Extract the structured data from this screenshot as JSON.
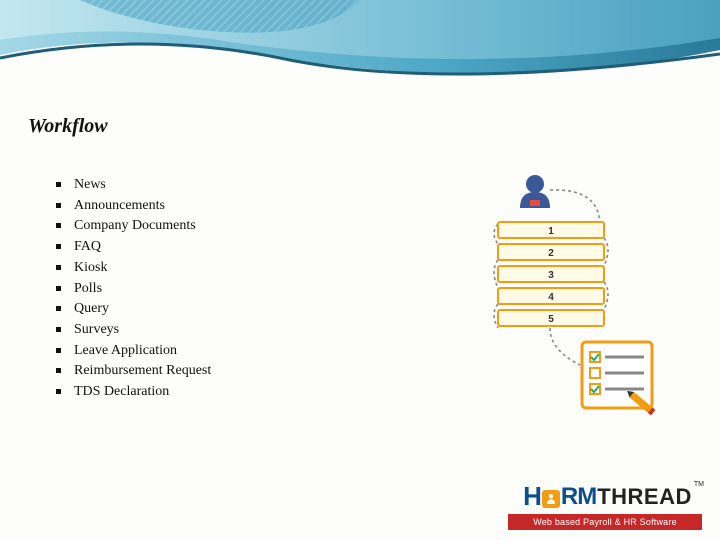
{
  "title": "Workflow",
  "bullets": [
    "News",
    "Announcements",
    "Company Documents",
    "FAQ",
    "Kiosk",
    "Polls",
    "Query",
    "Surveys",
    "Leave Application",
    "Reimbursement Request",
    "TDS Declaration"
  ],
  "diagram": {
    "steps": [
      "1",
      "2",
      "3",
      "4",
      "5"
    ],
    "colors": {
      "person_head": "#3b5998",
      "person_body": "#3b5998",
      "arrow_stroke": "#888",
      "step_border": "#f39c12",
      "step_fill": "#fffbe6",
      "step_text": "#333",
      "clipboard_border": "#f39c12",
      "clipboard_fill": "#fff",
      "clipboard_check": "#27ae60",
      "clipboard_line": "#888",
      "pencil": "#f39c12"
    }
  },
  "logo": {
    "h": "H",
    "rm": "RM",
    "thread": "THREAD",
    "tm": "TM",
    "tagline": "Web based Payroll & HR Software"
  }
}
